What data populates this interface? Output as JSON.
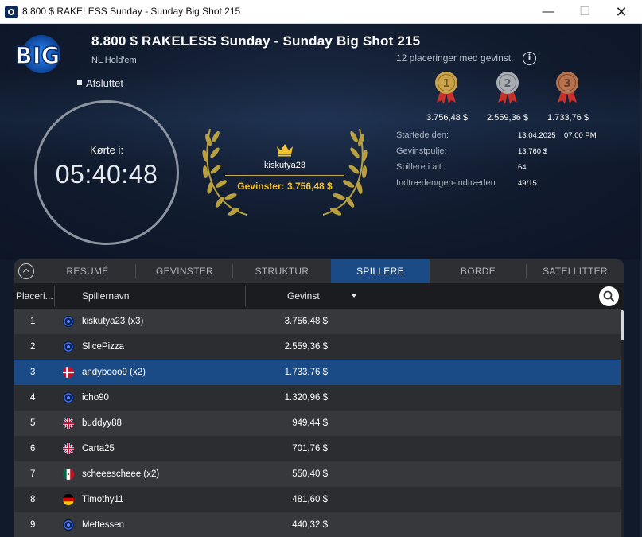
{
  "window": {
    "title": "8.800 $ RAKELESS Sunday - Sunday Big Shot 215",
    "minimize": "—",
    "maximize": "☐",
    "close": "✕"
  },
  "tournament": {
    "logo_text": "BIG",
    "title": "8.800 $ RAKELESS Sunday - Sunday Big Shot 215",
    "game": "NL Hold'em",
    "status": "Afsluttet",
    "ran_label": "Kørte i:",
    "duration": "05:40:48"
  },
  "winner": {
    "name": "kiskutya23",
    "prize_text": "Gevinster: 3.756,48 $"
  },
  "payouts": {
    "places_text": "12 placeringer med gevinst.",
    "info_icon": "i",
    "medals": [
      {
        "rank": "1",
        "value": "3.756,48 $",
        "color": "#c9a24a"
      },
      {
        "rank": "2",
        "value": "2.559,36 $",
        "color": "#a9adb3"
      },
      {
        "rank": "3",
        "value": "1.733,76 $",
        "color": "#b5734f"
      }
    ]
  },
  "stats": [
    {
      "label": "Startede den:",
      "value": "13.04.2025",
      "extra": "07:00 PM"
    },
    {
      "label": "Gevinstpulje:",
      "value": "13.760 $"
    },
    {
      "label": "Spillere i alt:",
      "value": "64"
    },
    {
      "label": "Indtræden/gen-indtræden",
      "value": "49/15"
    }
  ],
  "tabs": [
    {
      "label": "RESUMÉ",
      "active": false
    },
    {
      "label": "GEVINSTER",
      "active": false
    },
    {
      "label": "STRUKTUR",
      "active": false
    },
    {
      "label": "SPILLERE",
      "active": true
    },
    {
      "label": "BORDE",
      "active": false
    },
    {
      "label": "SATELLITTER",
      "active": false
    }
  ],
  "columns": {
    "place": "Placeri...",
    "name": "Spillernavn",
    "prize": "Gevinst"
  },
  "players": [
    {
      "place": "1",
      "name": "kiskutya23 (x3)",
      "prize": "3.756,48 $",
      "flag": "poker-globe"
    },
    {
      "place": "2",
      "name": "SlicePizza",
      "prize": "2.559,36 $",
      "flag": "poker-globe"
    },
    {
      "place": "3",
      "name": "andybooo9 (x2)",
      "prize": "1.733,76 $",
      "flag": "denmark",
      "selected": true
    },
    {
      "place": "4",
      "name": "icho90",
      "prize": "1.320,96 $",
      "flag": "poker-globe"
    },
    {
      "place": "5",
      "name": "buddyy88",
      "prize": "949,44 $",
      "flag": "united-kingdom"
    },
    {
      "place": "6",
      "name": "Carta25",
      "prize": "701,76 $",
      "flag": "united-kingdom"
    },
    {
      "place": "7",
      "name": "scheeescheee (x2)",
      "prize": "550,40 $",
      "flag": "mexico"
    },
    {
      "place": "8",
      "name": "Timothy11",
      "prize": "481,60 $",
      "flag": "germany"
    },
    {
      "place": "9",
      "name": "Mettessen",
      "prize": "440,32 $",
      "flag": "poker-globe"
    }
  ]
}
